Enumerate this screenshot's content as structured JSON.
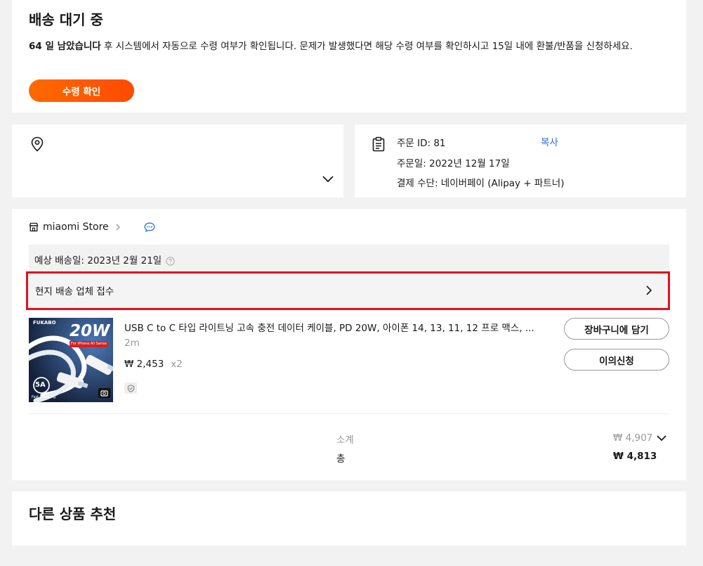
{
  "status": {
    "title": "배송 대기 중",
    "days_left": "64 일 남았습니다",
    "message": " 후 시스템에서 자동으로 수령 여부가 확인됩니다. 문제가 발생했다면 해당 수령 여부를 확인하시고 15일 내에 환불/반품을 신청하세요.",
    "confirm_label": "수령 확인"
  },
  "order": {
    "id_line": "주문 ID: 81",
    "copy_label": "복사",
    "date_line": "주문일: 2022년 12월 17일",
    "payment_line": "결제 수단: 네이버페이 (Alipay + 파트너)"
  },
  "store": {
    "name": "miaomi Store",
    "eta": "예상 배송일: 2023년 2월 21일",
    "tracking_status": "현지 배송 업체 접수"
  },
  "product": {
    "title": "USB C to C 타입 라이트닝 고속 충전 데이터 케이블, PD 20W, 아이폰 14, 13, 11, 12 프로 맥스, ...",
    "variant": "2m",
    "price": "₩ 2,453",
    "qty": "x2",
    "image_brand": "FUKABO",
    "image_badge": "20W",
    "image_caption": "For iPhone All Series",
    "image_amp": "5A",
    "image_sub": "Fast Charging",
    "add_cart_label": "장바구니에 담기",
    "dispute_label": "이의신청"
  },
  "summary": {
    "subtotal_label": "소계",
    "subtotal_value": "₩ 4,907",
    "total_label": "총",
    "total_value": "₩ 4,813"
  },
  "recommend": {
    "title": "다른 상품 추천"
  },
  "colors": {
    "accent_orange": "#ff6a00",
    "highlight_red": "#e0131e",
    "link_blue": "#2e6fd9"
  }
}
